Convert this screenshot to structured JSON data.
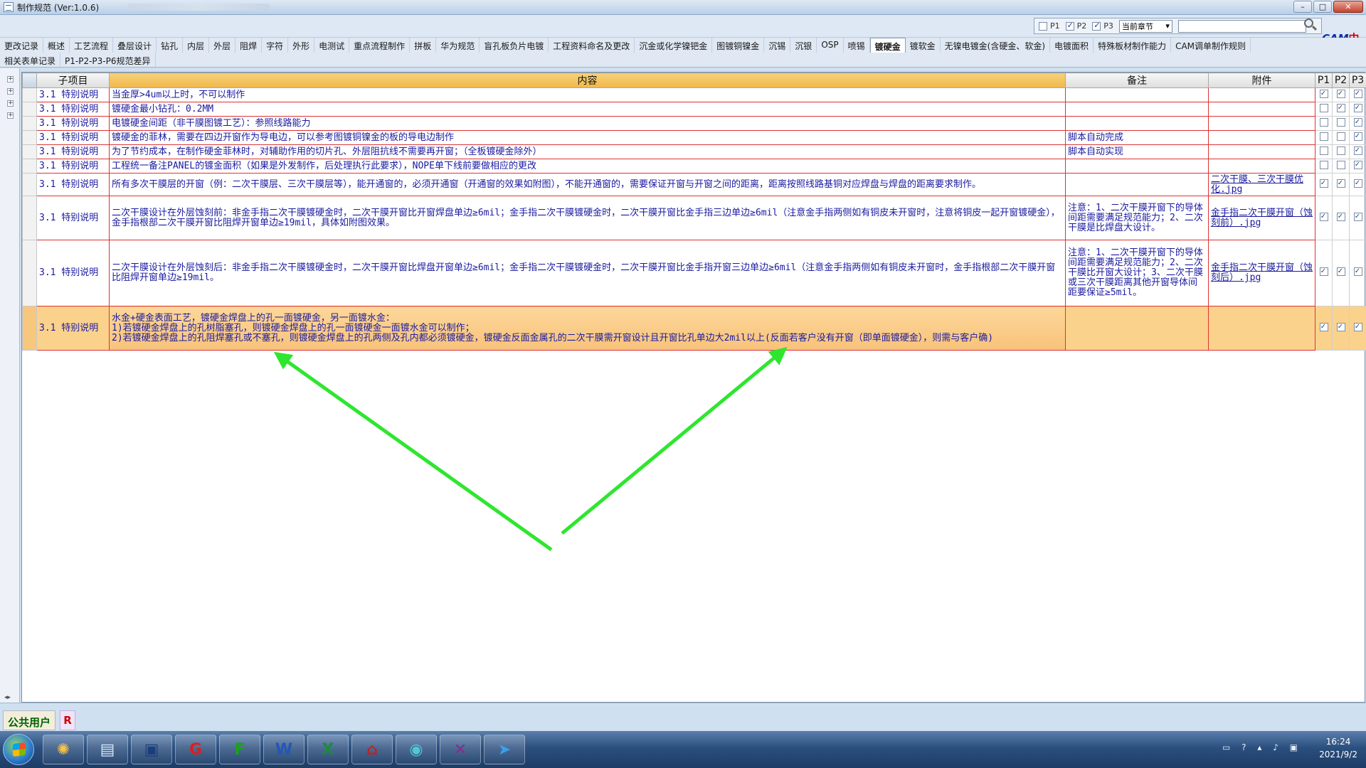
{
  "window": {
    "title": "制作规范 (Ver:1.0.6)",
    "controls": [
      "–",
      "□",
      "✕"
    ]
  },
  "toolbar": {
    "filters": [
      {
        "label": "P1",
        "checked": false
      },
      {
        "label": "P2",
        "checked": true
      },
      {
        "label": "P3",
        "checked": true
      }
    ],
    "scope_select": "当前章节",
    "search_value": "",
    "logo_text": "CAM",
    "logo_cn": "中心"
  },
  "tabs_row1": [
    "更改记录",
    "概述",
    "工艺流程",
    "叠层设计",
    "钻孔",
    "内层",
    "外层",
    "阻焊",
    "字符",
    "外形",
    "电测试",
    "重点流程制作",
    "拼板",
    "华为规范",
    "盲孔板负片电镀",
    "工程资料命名及更改",
    "沉金或化学镍钯金",
    "图镀铜镍金",
    "沉锡",
    "沉银",
    "OSP",
    "喷锡",
    "镀硬金",
    "镀软金",
    "无镍电镀金(含硬金、软金)",
    "电镀面积",
    "特殊板材制作能力",
    "CAM调单制作规则"
  ],
  "active_tab": "镀硬金",
  "tabs_row2": [
    "相关表单记录",
    "P1-P2-P3-P6规范差异"
  ],
  "grid": {
    "columns": [
      "",
      "子项目",
      "内容",
      "备注",
      "附件",
      "P1",
      "P2",
      "P3"
    ],
    "rows": [
      {
        "sub": "3.1 特别说明",
        "content": "当金厚>4um以上时，不可以制作",
        "note": "",
        "attachment": "",
        "p": [
          true,
          true,
          true
        ],
        "h": 20
      },
      {
        "sub": "3.1 特别说明",
        "content": "镀硬金最小钻孔：0.2MM",
        "note": "",
        "attachment": "",
        "p": [
          false,
          true,
          true
        ],
        "h": 20
      },
      {
        "sub": "3.1 特别说明",
        "content": "电镀硬金间距（非干膜图镀工艺）：参照线路能力",
        "note": "",
        "attachment": "",
        "p": [
          false,
          false,
          true
        ],
        "h": 20
      },
      {
        "sub": "3.1 特别说明",
        "content": "镀硬金的菲林，需要在四边开窗作为导电边，可以参考图镀铜镍金的板的导电边制作",
        "note": "脚本自动完成",
        "attachment": "",
        "p": [
          false,
          false,
          true
        ],
        "h": 20
      },
      {
        "sub": "3.1 特别说明",
        "content": "为了节约成本，在制作硬金菲林时，对辅助作用的切片孔、外层阻抗线不需要再开窗；（全板镀硬金除外）",
        "note": "脚本自动实现",
        "attachment": "",
        "p": [
          false,
          false,
          true
        ],
        "h": 20
      },
      {
        "sub": "3.1 特别说明",
        "content": "工程统一备注PANEL的镀金面积（如果是外发制作，后处理执行此要求），NOPE单下线前要做相应的更改",
        "note": "",
        "attachment": "",
        "p": [
          false,
          false,
          true
        ],
        "h": 20
      },
      {
        "sub": "3.1 特别说明",
        "content": "所有多次干膜层的开窗（例：二次干膜层、三次干膜层等），能开通窗的，必须开通窗（开通窗的效果如附图），不能开通窗的，需要保证开窗与开窗之间的距离，距离按照线路基铜对应焊盘与焊盘的距离要求制作。",
        "note": "",
        "attachment": "二次干膜、三次干膜优化.jpg",
        "p": [
          true,
          true,
          true
        ],
        "h": 32
      },
      {
        "sub": "3.1 特别说明",
        "content": "二次干膜设计在外层蚀刻前：非金手指二次干膜镀硬金时，二次干膜开窗比开窗焊盘单边≥6mil；金手指二次干膜镀硬金时，二次干膜开窗比金手指三边单边≥6mil（注意金手指两侧如有铜皮未开窗时，注意将铜皮一起开窗镀硬金），金手指根部二次干膜开窗比阻焊开窗单边≥19mil，具体如附图效果。",
        "note": "注意：1、二次干膜开窗下的导体间距需要满足规范能力；2、二次干膜是比焊盘大设计。",
        "attachment": "金手指二次干膜开窗（蚀刻前）.jpg",
        "p": [
          true,
          true,
          true
        ],
        "h": 62
      },
      {
        "sub": "3.1 特别说明",
        "content": "二次干膜设计在外层蚀刻后：非金手指二次干膜镀硬金时，二次干膜开窗比焊盘开窗单边≥6mil；金手指二次干膜镀硬金时，二次干膜开窗比金手指开窗三边单边≥6mil（注意金手指两侧如有铜皮未开窗时，金手指根部二次干膜开窗比阻焊开窗单边≥19mil。",
        "note": "注意：1、二次干膜开窗下的导体间距需要满足规范能力；2、二次干膜比开窗大设计；3、二次干膜或三次干膜距离其他开窗导体间距要保证≥5mil。",
        "attachment": "金手指二次干膜开窗（蚀刻后）.jpg",
        "p": [
          true,
          true,
          true
        ],
        "h": 93
      },
      {
        "sub": "3.1 特别说明",
        "content": "水金+硬金表面工艺，镀硬金焊盘上的孔一面镀硬金，另一面镀水金：\n1)若镀硬金焊盘上的孔树脂塞孔，则镀硬金焊盘上的孔一面镀硬金一面镀水金可以制作；\n2)若镀硬金焊盘上的孔阻焊塞孔或不塞孔，则镀硬金焊盘上的孔两侧及孔内都必须镀硬金，镀硬金反面金属孔的二次干膜需开窗设计且开窗比孔单边大2mil以上(反面若客户没有开窗（即单面镀硬金），则需与客户确)",
        "note": "",
        "attachment": "",
        "p": [
          true,
          true,
          true
        ],
        "h": 62,
        "highlight": true
      }
    ]
  },
  "status": {
    "user": "公共用户",
    "r_button": "R"
  },
  "taskbar": {
    "clock_time": "16:24",
    "clock_date": "2021/9/2"
  },
  "colors": {
    "arrow": "#2ee62e",
    "grid_text": "#1a1aa0",
    "row_border": "#dd3333",
    "highlight": "#fbd28c"
  }
}
